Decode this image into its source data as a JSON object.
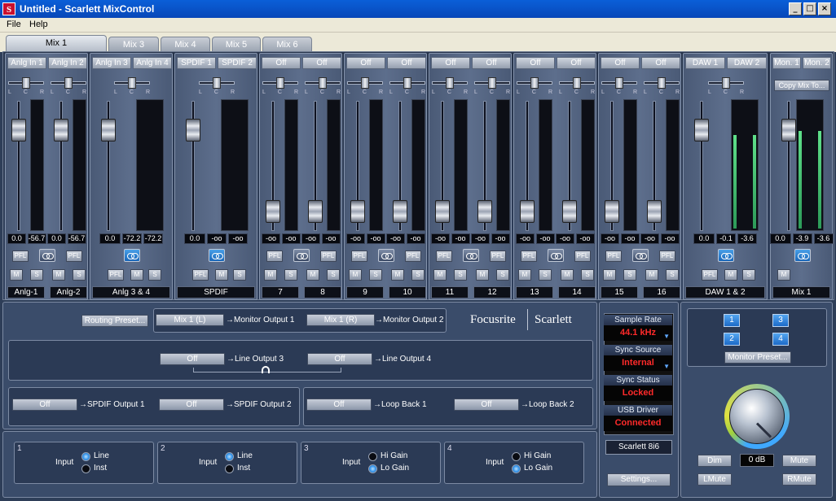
{
  "window": {
    "title": "Untitled - Scarlett MixControl",
    "icon_letter": "S",
    "min": "_",
    "max": "□",
    "close": "×"
  },
  "menu": [
    "File",
    "Help"
  ],
  "tabs": [
    "Mix 1",
    "Mix 3",
    "Mix 4",
    "Mix 5",
    "Mix 6"
  ],
  "strips": [
    {
      "srcs": [
        "Anlg In 1",
        "Anlg In 2"
      ],
      "readouts": [
        "0.0",
        "-56.7",
        "0.0",
        "-56.7"
      ],
      "names": [
        "Anlg-1",
        "Anlg-2"
      ],
      "stereo": false
    },
    {
      "srcs": [
        "Anlg In 3",
        "Anlg In 4"
      ],
      "readouts": [
        "0.0",
        "-72.2",
        "-72.2"
      ],
      "names": [
        "Anlg 3 & 4"
      ],
      "stereo": true
    },
    {
      "srcs": [
        "SPDIF 1",
        "SPDIF 2"
      ],
      "readouts": [
        "0.0",
        "-oo",
        "-oo"
      ],
      "names": [
        "SPDIF"
      ],
      "stereo": true
    },
    {
      "srcs": [
        "Off",
        "Off"
      ],
      "readouts": [
        "-oo",
        "-oo",
        "-oo",
        "-oo"
      ],
      "names": [
        "7",
        "8"
      ],
      "stereo": false
    },
    {
      "srcs": [
        "Off",
        "Off"
      ],
      "readouts": [
        "-oo",
        "-oo",
        "-oo",
        "-oo"
      ],
      "names": [
        "9",
        "10"
      ],
      "stereo": false
    },
    {
      "srcs": [
        "Off",
        "Off"
      ],
      "readouts": [
        "-oo",
        "-oo",
        "-oo",
        "-oo"
      ],
      "names": [
        "11",
        "12"
      ],
      "stereo": false
    },
    {
      "srcs": [
        "Off",
        "Off"
      ],
      "readouts": [
        "-oo",
        "-oo",
        "-oo",
        "-oo"
      ],
      "names": [
        "13",
        "14"
      ],
      "stereo": false
    },
    {
      "srcs": [
        "Off",
        "Off"
      ],
      "readouts": [
        "-oo",
        "-oo",
        "-oo",
        "-oo"
      ],
      "names": [
        "15",
        "16"
      ],
      "stereo": false
    },
    {
      "srcs": [
        "DAW 1",
        "DAW 2"
      ],
      "readouts": [
        "0.0",
        "-0.1",
        "-3.6"
      ],
      "names": [
        "DAW 1 & 2"
      ],
      "stereo": true
    },
    {
      "srcs": [
        "Mon. 1",
        "Mon. 2"
      ],
      "readouts": [
        "0.0",
        "-3.9",
        "-3.6"
      ],
      "names": [
        "Mix 1"
      ],
      "stereo": true,
      "copy": "Copy Mix To..."
    }
  ],
  "pan_labels": [
    "L",
    "C",
    "R"
  ],
  "btn_labels": {
    "pfl": "PFL",
    "mute": "M",
    "solo": "S"
  },
  "routing": {
    "preset": "Routing Preset...",
    "mon1_src": "Mix 1 (L)",
    "mon1_dst": "→Monitor Output 1",
    "mon2_src": "Mix 1 (R)",
    "mon2_dst": "→Monitor Output 2",
    "line3_src": "Off",
    "line3_dst": "→Line Output 3",
    "line4_src": "Off",
    "line4_dst": "→Line Output 4",
    "spdif1_src": "Off",
    "spdif1_dst": "→SPDIF Output 1",
    "spdif2_src": "Off",
    "spdif2_dst": "→SPDIF Output 2",
    "loop1_src": "Off",
    "loop1_dst": "→Loop Back 1",
    "loop2_src": "Off",
    "loop2_dst": "→Loop Back 2"
  },
  "brand": {
    "left": "Focusrite",
    "right": "Scarlett"
  },
  "inputs": [
    {
      "num": "1",
      "label": "Input",
      "opt1": "Line",
      "opt2": "Inst",
      "selected": 1
    },
    {
      "num": "2",
      "label": "Input",
      "opt1": "Line",
      "opt2": "Inst",
      "selected": 1
    },
    {
      "num": "3",
      "label": "Input",
      "opt1": "Hi Gain",
      "opt2": "Lo Gain",
      "selected": 2
    },
    {
      "num": "4",
      "label": "Input",
      "opt1": "Hi Gain",
      "opt2": "Lo Gain",
      "selected": 2
    }
  ],
  "sync": {
    "sr_label": "Sample Rate",
    "sr_value": "44.1 kHz",
    "src_label": "Sync Source",
    "src_value": "Internal",
    "status_label": "Sync Status",
    "status_value": "Locked",
    "usb_label": "USB  Driver",
    "usb_value": "Connected",
    "device": "Scarlett 8i6",
    "settings": "Settings..."
  },
  "monitor": {
    "nums": [
      "1",
      "3",
      "2",
      "4"
    ],
    "preset": "Monitor Preset...",
    "dim": "Dim",
    "level": "0 dB",
    "mute": "Mute",
    "lmute": "LMute",
    "rmute": "RMute"
  }
}
